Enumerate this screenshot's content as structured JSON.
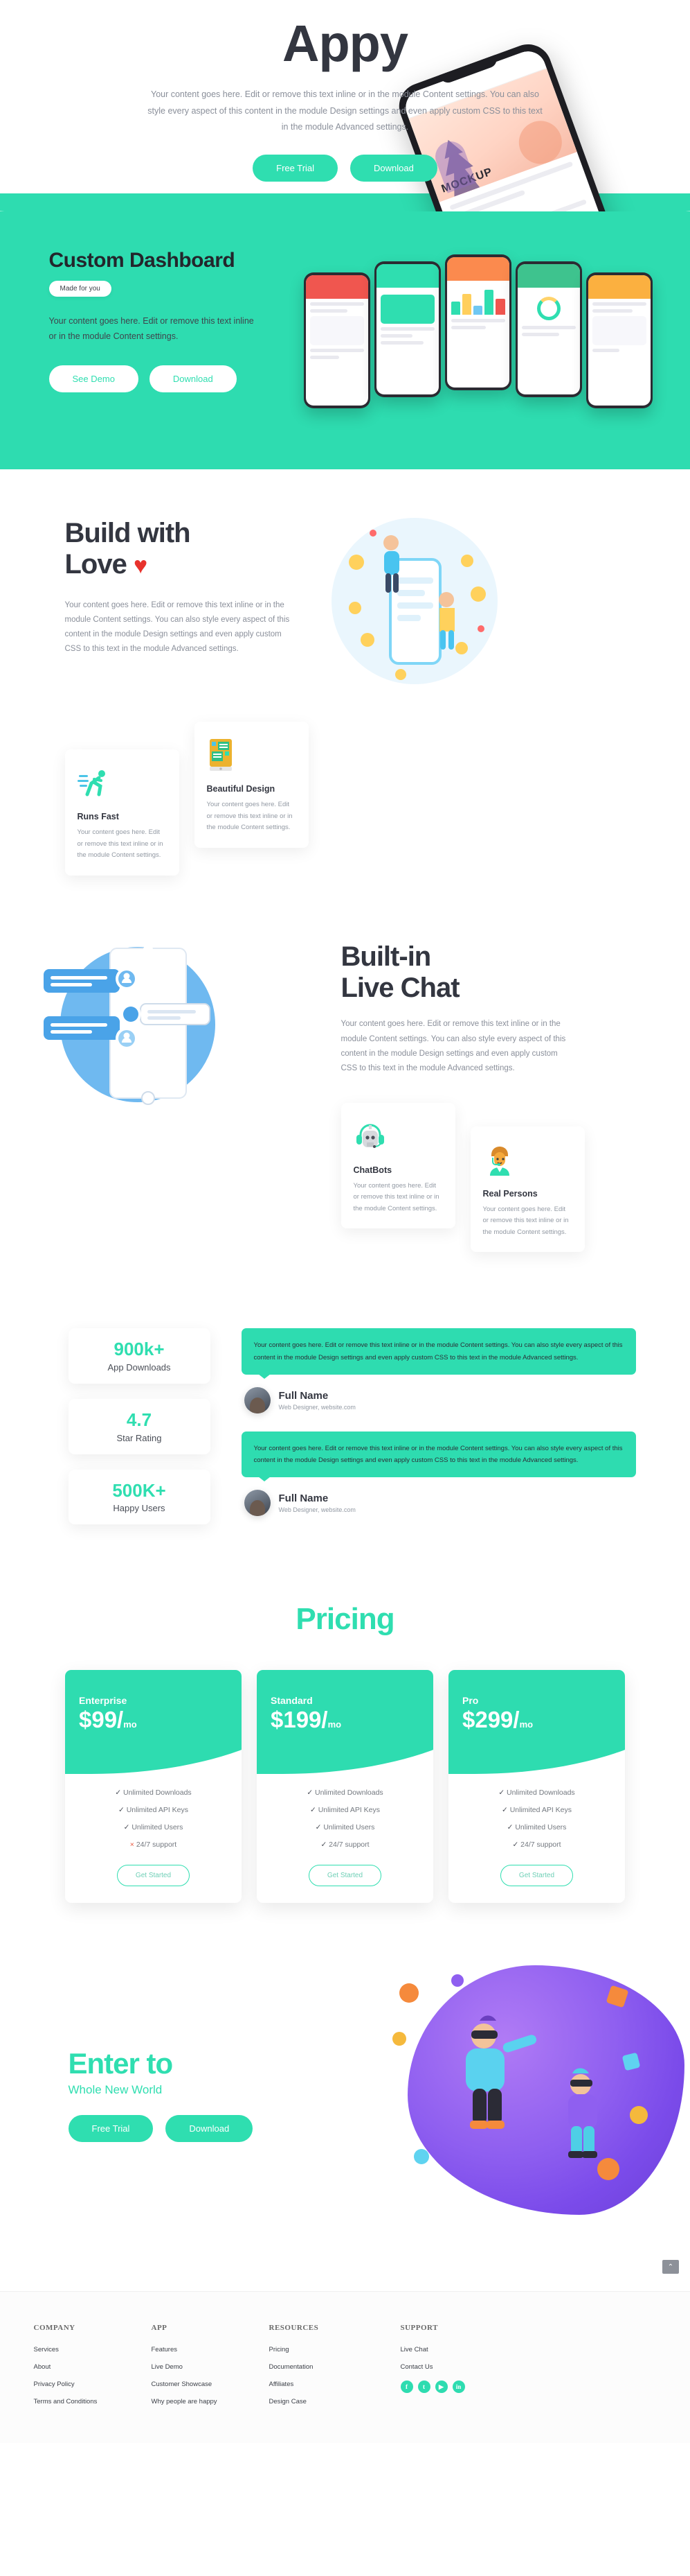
{
  "hero": {
    "title": "Appy",
    "text": "Your content goes here. Edit or remove this text inline or in the module Content settings. You can also style every aspect of this content in the module Design settings and even apply custom CSS to this text in the module Advanced settings.",
    "btn_primary": "Free Trial",
    "btn_secondary": "Download",
    "phone_word": "MOCKUP"
  },
  "dashboard": {
    "title": "Custom Dashboard",
    "badge": "Made for you",
    "text": "Your content goes here. Edit or remove this text inline or in the module Content settings.",
    "btn_primary": "See Demo",
    "btn_secondary": "Download"
  },
  "build": {
    "title_line1": "Build with",
    "title_line2": "Love",
    "heart": "♥",
    "text": "Your content goes here. Edit or remove this text inline or in the module Content settings. You can also style every aspect of this content in the module Design settings and even apply custom CSS to this text in the module Advanced settings.",
    "cards": [
      {
        "icon": "runner-icon",
        "title": "Runs Fast",
        "text": "Your content goes here. Edit or remove this text inline or in the module Content settings."
      },
      {
        "icon": "design-panel-icon",
        "title": "Beautiful Design",
        "text": "Your content goes here. Edit or remove this text inline or in the module Content settings."
      }
    ]
  },
  "chat": {
    "title_line1": "Built-in",
    "title_line2": "Live Chat",
    "text": "Your content goes here. Edit or remove this text inline or in the module Content settings. You can also style every aspect of this content in the module Design settings and even apply custom CSS to this text in the module Advanced settings.",
    "cards": [
      {
        "icon": "robot-headset-icon",
        "title": "ChatBots",
        "text": "Your content goes here. Edit or remove this text inline or in the module Content settings."
      },
      {
        "icon": "support-agent-icon",
        "title": "Real Persons",
        "text": "Your content goes here. Edit or remove this text inline or in the module Content settings."
      }
    ]
  },
  "stats": [
    {
      "number": "900k+",
      "label": "App Downloads"
    },
    {
      "number": "4.7",
      "label": "Star Rating"
    },
    {
      "number": "500K+",
      "label": "Happy Users"
    }
  ],
  "testimonials": [
    {
      "quote": "Your content goes here. Edit or remove this text inline or in the module Content settings. You can also style every aspect of this content in the module Design settings and even apply custom CSS to this text in the module Advanced settings.",
      "name": "Full Name",
      "role": "Web Designer, website.com"
    },
    {
      "quote": "Your content goes here. Edit or remove this text inline or in the module Content settings. You can also style every aspect of this content in the module Design settings and even apply custom CSS to this text in the module Advanced settings.",
      "name": "Full Name",
      "role": "Web Designer, website.com"
    }
  ],
  "pricing": {
    "title": "Pricing",
    "plans": [
      {
        "plan": "Enterprise",
        "price": "$99/",
        "period": "mo",
        "features": [
          {
            "mark": "✓",
            "text": "Unlimited Downloads",
            "included": true
          },
          {
            "mark": "✓",
            "text": "Unlimited API Keys",
            "included": true
          },
          {
            "mark": "✓",
            "text": "Unlimited Users",
            "included": true
          },
          {
            "mark": "×",
            "text": "24/7 support",
            "included": false
          }
        ],
        "cta": "Get Started"
      },
      {
        "plan": "Standard",
        "price": "$199/",
        "period": "mo",
        "features": [
          {
            "mark": "✓",
            "text": "Unlimited Downloads",
            "included": true
          },
          {
            "mark": "✓",
            "text": "Unlimited API Keys",
            "included": true
          },
          {
            "mark": "✓",
            "text": "Unlimited Users",
            "included": true
          },
          {
            "mark": "✓",
            "text": "24/7 support",
            "included": true
          }
        ],
        "cta": "Get Started"
      },
      {
        "plan": "Pro",
        "price": "$299/",
        "period": "mo",
        "features": [
          {
            "mark": "✓",
            "text": "Unlimited Downloads",
            "included": true
          },
          {
            "mark": "✓",
            "text": "Unlimited API Keys",
            "included": true
          },
          {
            "mark": "✓",
            "text": "Unlimited Users",
            "included": true
          },
          {
            "mark": "✓",
            "text": "24/7 support",
            "included": true
          }
        ],
        "cta": "Get Started"
      }
    ]
  },
  "world": {
    "title": "Enter to",
    "subtitle": "Whole New World",
    "btn_primary": "Free Trial",
    "btn_secondary": "Download"
  },
  "footer": {
    "columns": [
      {
        "title": "COMPANY",
        "links": [
          "Services",
          "About",
          "Privacy Policy",
          "Terms and Conditions"
        ]
      },
      {
        "title": "APP",
        "links": [
          "Features",
          "Live Demo",
          "Customer Showcase",
          "Why people are happy"
        ]
      },
      {
        "title": "RESOURCES",
        "links": [
          "Pricing",
          "Documentation",
          "Affiliates",
          "Design Case"
        ]
      },
      {
        "title": "SUPPORT",
        "links": [
          "Live Chat",
          "Contact Us"
        ]
      }
    ],
    "socials": [
      {
        "name": "facebook-icon",
        "glyph": "f"
      },
      {
        "name": "twitter-icon",
        "glyph": "t"
      },
      {
        "name": "youtube-icon",
        "glyph": "▶"
      },
      {
        "name": "linkedin-icon",
        "glyph": "in"
      }
    ],
    "to_top": "⌃"
  },
  "colors": {
    "accent": "#2edcb0",
    "dark": "#333640",
    "muted": "#8a8f9a",
    "heart": "#e8322c",
    "purple": "#8f5ff0"
  }
}
